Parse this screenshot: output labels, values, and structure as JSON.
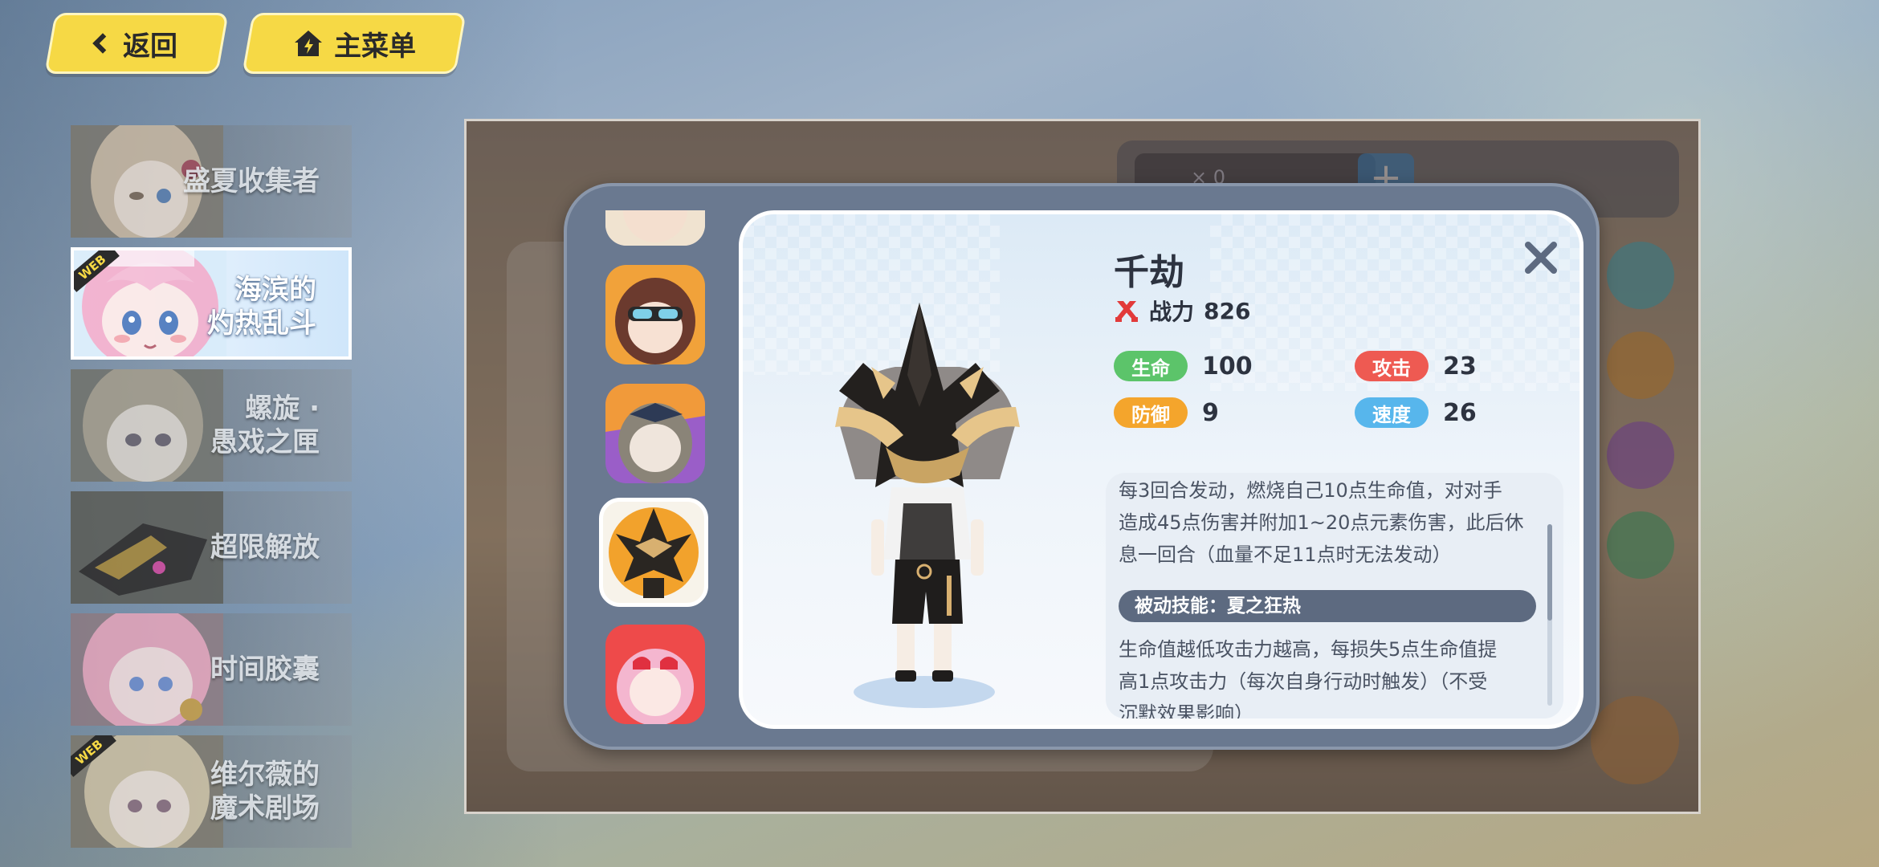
{
  "nav": {
    "back_label": "返回",
    "main_menu_label": "主菜单"
  },
  "events": [
    {
      "label": "盛夏收集者",
      "active": false,
      "web": false
    },
    {
      "label": "海滨的灼热乱斗",
      "line1": "海滨的",
      "line2": "灼热乱斗",
      "active": true,
      "web": true
    },
    {
      "label": "螺旋·愚戏之匣",
      "line1": "螺旋 ·",
      "line2": "愚戏之匣",
      "active": false,
      "web": false
    },
    {
      "label": "超限解放",
      "active": false,
      "web": false
    },
    {
      "label": "时间胶囊",
      "active": false,
      "web": false
    },
    {
      "label": "维尔薇的魔术剧场",
      "line1": "维尔薇的",
      "line2": "魔术剧场",
      "active": false,
      "web": true
    }
  ],
  "web_tag": "WEB",
  "game": {
    "gem_count": "× 0",
    "plus": "+"
  },
  "character": {
    "name": "千劫",
    "power_label": "战力",
    "power_value": "826",
    "stats": {
      "hp_label": "生命",
      "hp_value": "100",
      "atk_label": "攻击",
      "atk_value": "23",
      "def_label": "防御",
      "def_value": "9",
      "spd_label": "速度",
      "spd_value": "26"
    },
    "active_skill": "每3回合发动，燃烧自己10点生命值，对对手造成45点伤害并附加1~20点元素伤害，此后休息一回合（血量不足11点时无法发动）",
    "active_skill_lines": [
      "每3回合发动，燃烧自己10点生命值，对对手",
      "造成45点伤害并附加1~20点元素伤害，此后休",
      "息一回合（血量不足11点时无法发动）"
    ],
    "passive_title": "被动技能：夏之狂热",
    "passive_skill_lines": [
      "生命值越低攻击力越高，每损失5点生命值提",
      "高1点攻击力（每次自身行动时触发）（不受",
      "沉默效果影响）"
    ]
  },
  "colors": {
    "nav_yellow": "#f6d945",
    "hp_green": "#5cc46a",
    "atk_red": "#ee5a52",
    "def_orange": "#f4a52c",
    "spd_blue": "#57b6ec",
    "popup_slate": "#6a7990"
  },
  "icons": [
    "chevron-left-icon",
    "home-icon",
    "power-icon",
    "close-icon"
  ]
}
